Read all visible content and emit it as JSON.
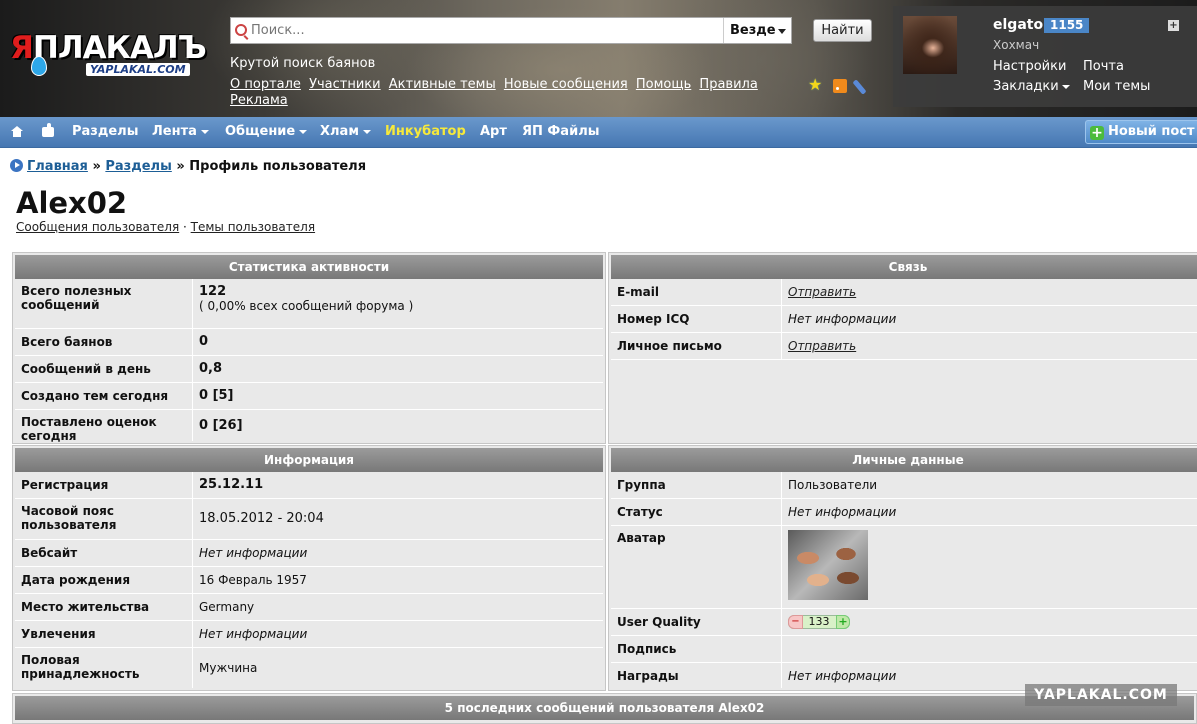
{
  "header": {
    "logo_text_red": "Я",
    "logo_text_white": "ПЛАКАЛЪ",
    "logo_sub": "YAPLAKAL.COM",
    "search_placeholder": "Поиск...",
    "search_scope": "Везде",
    "search_button": "Найти",
    "tagline": "Крутой поиск баянов",
    "links": [
      "О портале",
      "Участники",
      "Активные темы",
      "Новые сообщения",
      "Помощь",
      "Правила",
      "Реклама"
    ]
  },
  "user": {
    "name": "elgato",
    "count": "1155",
    "rank": "Хохмач",
    "settings": "Настройки",
    "mail": "Почта",
    "bookmarks": "Закладки",
    "my_topics": "Мои темы"
  },
  "nav": {
    "items": [
      "Разделы",
      "Лента",
      "Общение",
      "Хлам",
      "Инкубатор",
      "Арт",
      "ЯП Файлы"
    ],
    "new_post": "Новый пост"
  },
  "breadcrumb": {
    "home": "Главная",
    "sep": "»",
    "sections": "Разделы",
    "current": "Профиль пользователя"
  },
  "profile": {
    "name": "Alex02",
    "link_posts": "Сообщения пользователя",
    "dot": "·",
    "link_topics": "Темы пользователя"
  },
  "stats": {
    "title": "Статистика активности",
    "rows": [
      {
        "k": "Всего полезных сообщений",
        "v": "122",
        "v2": "( 0,00% всех сообщений форума )"
      },
      {
        "k": "Всего баянов",
        "v": "0"
      },
      {
        "k": "Сообщений в день",
        "v": "0,8"
      },
      {
        "k": "Создано тем сегодня",
        "v": "0 [5]"
      },
      {
        "k": "Поставлено оценок сегодня",
        "v": "0 [26]"
      }
    ]
  },
  "contact": {
    "title": "Связь",
    "rows": [
      {
        "k": "E-mail",
        "v": "Отправить"
      },
      {
        "k": "Номер ICQ",
        "v": "Нет информации"
      },
      {
        "k": "Личное письмо",
        "v": "Отправить"
      }
    ]
  },
  "info": {
    "title": "Информация",
    "rows": [
      {
        "k": "Регистрация",
        "v": "25.12.11"
      },
      {
        "k": "Часовой пояс пользователя",
        "v": "18.05.2012 - 20:04"
      },
      {
        "k": "Вебсайт",
        "v": "Нет информации"
      },
      {
        "k": "Дата рождения",
        "v": "16 Февраль 1957"
      },
      {
        "k": "Место жительства",
        "v": "Germany"
      },
      {
        "k": "Увлечения",
        "v": "Нет информации"
      },
      {
        "k": "Половая принадлежность",
        "v": "Мужчина"
      }
    ]
  },
  "personal": {
    "title": "Личные данные",
    "rows": [
      {
        "k": "Группа",
        "v": "Пользователи"
      },
      {
        "k": "Статус",
        "v": "Нет информации"
      },
      {
        "k": "Аватар",
        "v": ""
      },
      {
        "k": "User Quality",
        "v": "133"
      },
      {
        "k": "Подпись",
        "v": ""
      },
      {
        "k": "Награды",
        "v": "Нет информации"
      }
    ]
  },
  "last_posts_title": "5 последних сообщений пользователя Alex02",
  "watermark": "YAPLAKAL.COM",
  "icons": [
    "search-icon",
    "star-icon",
    "rss-icon",
    "pen-icon",
    "home-icon",
    "like-icon",
    "plus-icon",
    "bullet-icon"
  ]
}
